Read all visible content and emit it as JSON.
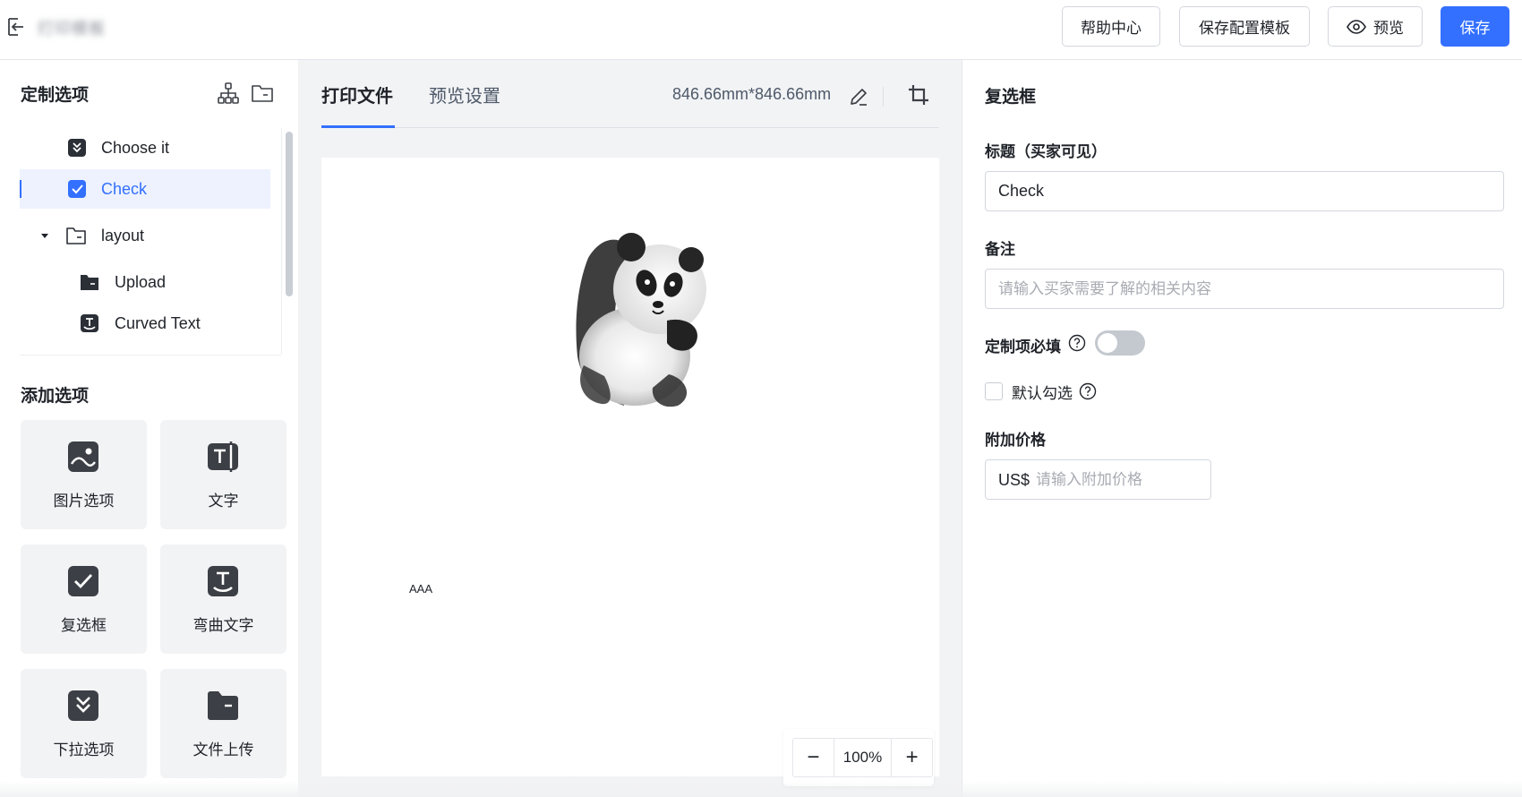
{
  "header": {
    "app_title": "打印模板",
    "help_label": "帮助中心",
    "save_template_label": "保存配置模板",
    "preview_label": "预览",
    "save_label": "保存"
  },
  "sidebar": {
    "title": "定制选项",
    "tree": [
      {
        "label": "Choose it",
        "icon": "dropdown-icon"
      },
      {
        "label": "Check",
        "icon": "checkbox-icon",
        "selected": true
      },
      {
        "label": "layout",
        "icon": "folder-outline-icon",
        "expanded": true
      },
      {
        "label": "Upload",
        "icon": "folder-filled-icon"
      },
      {
        "label": "Curved Text",
        "icon": "curved-text-icon"
      }
    ],
    "add_title": "添加选项",
    "tiles": [
      {
        "label": "图片选项",
        "icon": "image-icon"
      },
      {
        "label": "文字",
        "icon": "text-icon"
      },
      {
        "label": "复选框",
        "icon": "checkbox-icon"
      },
      {
        "label": "弯曲文字",
        "icon": "curved-text-icon"
      },
      {
        "label": "下拉选项",
        "icon": "dropdown-icon"
      },
      {
        "label": "文件上传",
        "icon": "folder-filled-icon"
      }
    ]
  },
  "center": {
    "tabs": [
      {
        "label": "打印文件",
        "active": true
      },
      {
        "label": "预览设置",
        "active": false
      }
    ],
    "dimensions": "846.66mm*846.66mm",
    "canvas_text": "AAA",
    "zoom": "100%",
    "zoom_minus": "−",
    "zoom_plus": "+"
  },
  "panel": {
    "title": "复选框",
    "title_label": "标题（买家可见）",
    "title_value": "Check",
    "note_label": "备注",
    "note_placeholder": "请输入买家需要了解的相关内容",
    "required_label": "定制项必填",
    "required_on": false,
    "default_checked_label": "默认勾选",
    "default_checked": false,
    "price_label": "附加价格",
    "price_prefix": "US$",
    "price_placeholder": "请输入附加价格"
  },
  "colors": {
    "accent": "#3370ff",
    "selected_bg": "#edf2fe",
    "canvas_bg": "#f2f3f5",
    "icon_dark": "#3c4046"
  }
}
